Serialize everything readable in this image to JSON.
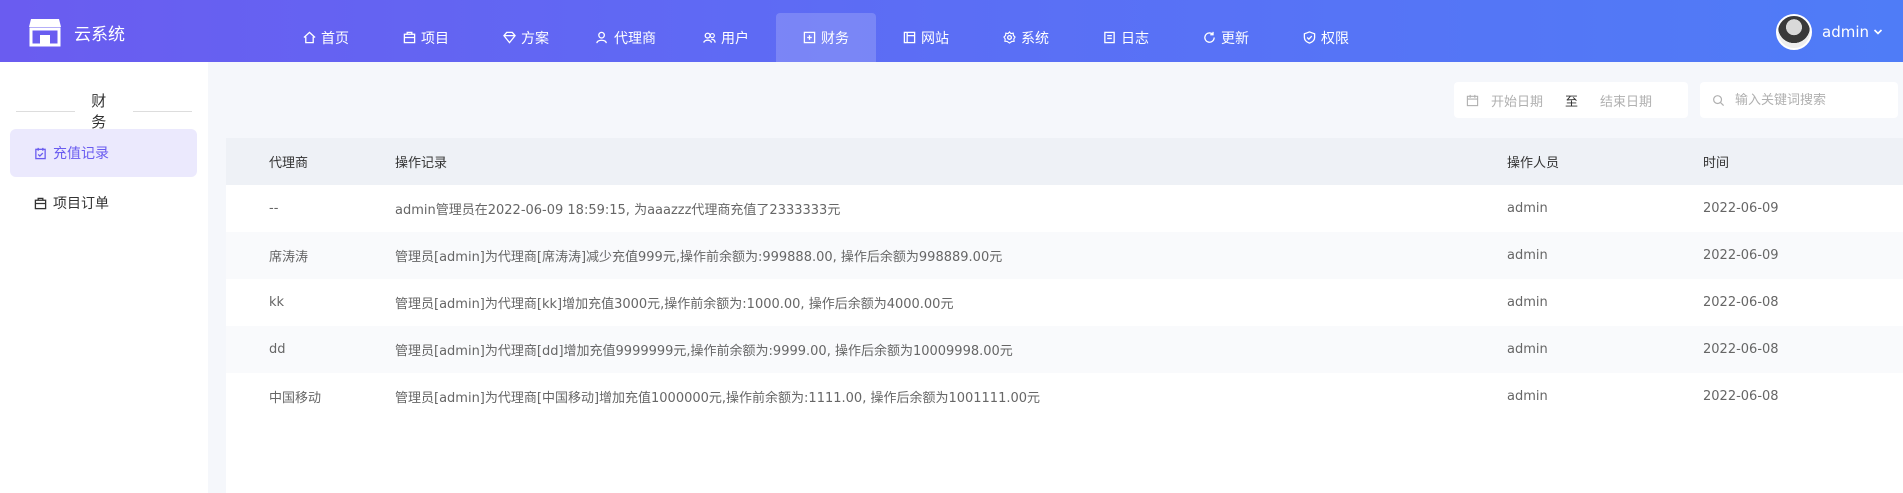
{
  "header": {
    "app_title": "云系统",
    "nav": [
      {
        "label": "首页",
        "icon": "home-icon"
      },
      {
        "label": "项目",
        "icon": "box-icon"
      },
      {
        "label": "方案",
        "icon": "diamond-icon"
      },
      {
        "label": "代理商",
        "icon": "user-group-icon"
      },
      {
        "label": "用户",
        "icon": "users-icon"
      },
      {
        "label": "财务",
        "icon": "finance-icon",
        "active": true
      },
      {
        "label": "网站",
        "icon": "web-icon"
      },
      {
        "label": "系统",
        "icon": "settings-icon"
      },
      {
        "label": "日志",
        "icon": "log-icon"
      },
      {
        "label": "更新",
        "icon": "refresh-icon"
      },
      {
        "label": "权限",
        "icon": "shield-icon"
      }
    ],
    "user_name": "admin"
  },
  "sidebar": {
    "title": "财务",
    "items": [
      {
        "label": "充值记录",
        "icon": "recharge-icon",
        "active": true
      },
      {
        "label": "项目订单",
        "icon": "order-icon"
      }
    ]
  },
  "filters": {
    "start_placeholder": "开始日期",
    "separator": "至",
    "end_placeholder": "结束日期",
    "search_placeholder": "输入关键词搜索"
  },
  "table": {
    "columns": [
      "代理商",
      "操作记录",
      "操作人员",
      "时间"
    ],
    "rows": [
      [
        "--",
        "admin管理员在2022-06-09 18:59:15, 为aaazzz代理商充值了2333333元",
        "admin",
        "2022-06-09"
      ],
      [
        "席涛涛",
        "管理员[admin]为代理商[席涛涛]减少充值999元,操作前余额为:999888.00, 操作后余额为998889.00元",
        "admin",
        "2022-06-09"
      ],
      [
        "kk",
        "管理员[admin]为代理商[kk]增加充值3000元,操作前余额为:1000.00, 操作后余额为4000.00元",
        "admin",
        "2022-06-08"
      ],
      [
        "dd",
        "管理员[admin]为代理商[dd]增加充值9999999元,操作前余额为:9999.00, 操作后余额为10009998.00元",
        "admin",
        "2022-06-08"
      ],
      [
        "中国移动",
        "管理员[admin]为代理商[中国移动]增加充值1000000元,操作前余额为:1111.00, 操作后余额为1001111.00元",
        "admin",
        "2022-06-08"
      ]
    ]
  }
}
